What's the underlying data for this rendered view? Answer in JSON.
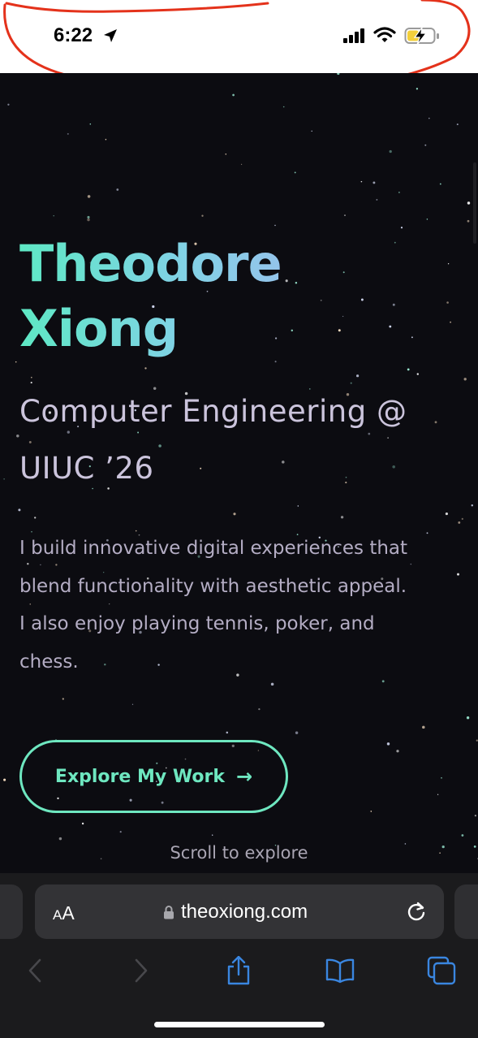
{
  "status_bar": {
    "time": "6:22",
    "icons": [
      "location-arrow-icon",
      "cellular-signal-icon",
      "wifi-icon",
      "battery-charging-icon"
    ]
  },
  "hero": {
    "name_line1": "Theodore",
    "name_line2": "Xiong",
    "subtitle_line1": "Computer Engineering @",
    "subtitle_line2": "UIUC ’26",
    "description_line1": "I build innovative digital experiences that",
    "description_line2": "blend functionality with aesthetic appeal.",
    "description_line3": "I also enjoy playing tennis, poker, and",
    "description_line4": "chess.",
    "cta_label": "Explore My Work",
    "cta_arrow": "→",
    "scroll_hint": "Scroll to explore"
  },
  "browser": {
    "aa_small": "A",
    "aa_large": "A",
    "url": "theoxiong.com",
    "toolbar_icons": [
      "back-icon",
      "forward-icon",
      "share-icon",
      "bookmarks-icon",
      "tabs-icon"
    ]
  },
  "colors": {
    "page_background": "#0c0c11",
    "accent": "#6ee7c0",
    "gradient_start": "#5ee8c4",
    "gradient_end": "#a3b9f0",
    "annotation": "#e4321b",
    "toolbar_icon": "#3a86e0"
  }
}
